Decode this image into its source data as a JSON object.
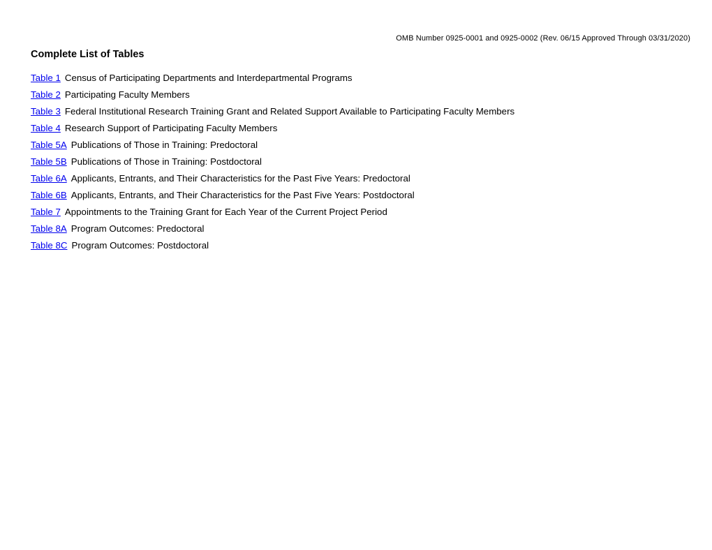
{
  "document": {
    "omb_header": "OMB Number 0925-0001 and 0925-0002 (Rev. 06/15 Approved Through 03/31/2020)",
    "title": "Complete List of Tables"
  },
  "toc": {
    "entries": [
      {
        "link": "Table 1",
        "description": "Census of Participating Departments and Interdepartmental Programs"
      },
      {
        "link": "Table 2",
        "description": "Participating Faculty Members"
      },
      {
        "link": "Table 3",
        "description": "Federal Institutional Research Training Grant and Related Support Available to Participating Faculty Members"
      },
      {
        "link": "Table 4",
        "description": "Research Support of Participating Faculty Members"
      },
      {
        "link": "Table 5A",
        "description": "Publications of Those in Training: Predoctoral"
      },
      {
        "link": "Table 5B",
        "description": "Publications of Those in Training: Postdoctoral"
      },
      {
        "link": "Table 6A",
        "description": "Applicants, Entrants, and Their Characteristics for the Past Five Years: Predoctoral"
      },
      {
        "link": "Table 6B",
        "description": "Applicants, Entrants, and Their Characteristics for the Past Five Years: Postdoctoral"
      },
      {
        "link": "Table 7",
        "description": "Appointments to the Training Grant for Each Year of the Current Project Period"
      },
      {
        "link": "Table 8A",
        "description": "Program Outcomes: Predoctoral"
      },
      {
        "link": "Table 8C",
        "description": "Program Outcomes: Postdoctoral"
      }
    ]
  },
  "colors": {
    "link": "#0000ee",
    "text": "#000000",
    "background": "#ffffff"
  }
}
